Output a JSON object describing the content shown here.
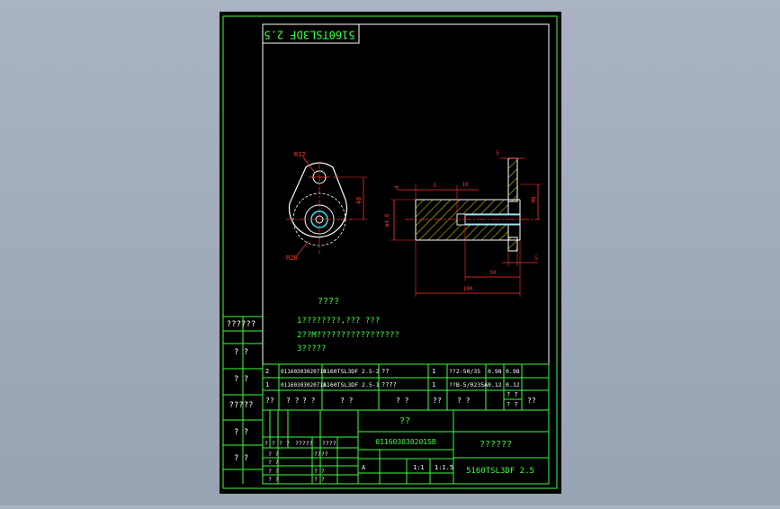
{
  "drawing": {
    "rotated_code": "5160TSL3DF 2.5",
    "views": {
      "left": {
        "radius_top": "R12",
        "radius_bottom": "R28",
        "height_dim": "48"
      },
      "right": {
        "dims": {
          "small_left": "4",
          "five": "5",
          "ten": "10",
          "top_small": "5",
          "vertical_right": "M8",
          "left_dia": "ø4.6",
          "fifty": "50",
          "hundred": "100",
          "small_right": "5"
        }
      }
    },
    "notes": {
      "heading": "????",
      "lines": [
        "1????????,??? ???",
        "2??M?????????????????",
        "3?????"
      ]
    },
    "left_strip": [
      "??????",
      "? ?",
      "? ?",
      "?????",
      "? ?",
      "? ?"
    ],
    "bom": {
      "rows": [
        [
          "2",
          "0116030302071B",
          "5160TSL3DF 2.5-2",
          "??",
          "1",
          "??2-50/35",
          "0.98",
          "0.98"
        ],
        [
          "1",
          "0116030302071A",
          "5160TSL3DF 2.5-1",
          "????",
          "1",
          "??B-5/0235A",
          "0.12",
          "0.12"
        ]
      ],
      "header": [
        "??",
        "? ?",
        "? ?",
        "? ?",
        "? ?",
        "??",
        "? ?",
        "? ?",
        "? ?",
        "??"
      ]
    },
    "title_block": {
      "material": "??",
      "drawing_no": "0116030302015B",
      "part_name": "??????",
      "model": "5160TSL3DF 2.5",
      "left_labels": [
        "? ?",
        "? ?",
        "?????",
        "????",
        "? ?",
        "? ?",
        "? ?",
        "? ?"
      ],
      "mid_labels": [
        "????",
        "? ?",
        "? ?"
      ],
      "stage": "A",
      "scale_a": "1:1",
      "scale_b": "1:1.5"
    }
  }
}
